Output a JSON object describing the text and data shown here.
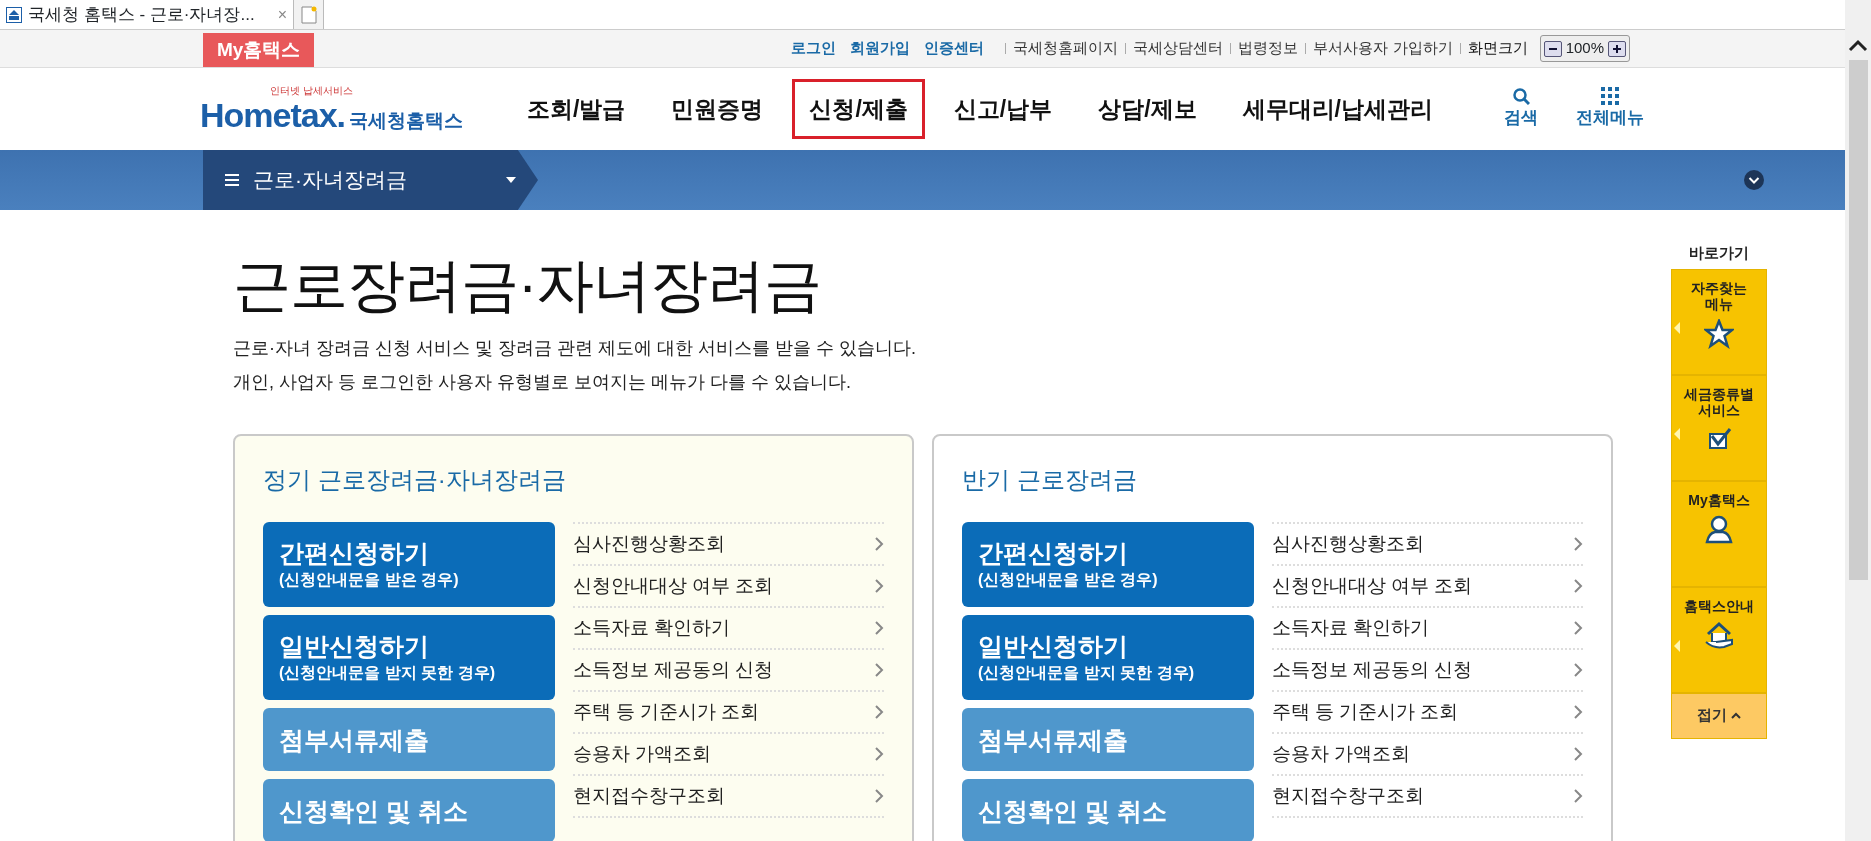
{
  "browser_tab": {
    "title": "국세청 홈택스 - 근로·자녀장...",
    "close": "×"
  },
  "top_bar": {
    "my_hometax": "My홈택스",
    "links": [
      {
        "text": "로그인",
        "kind": "primary"
      },
      {
        "text": "회원가입",
        "kind": "primary"
      },
      {
        "text": "인증센터",
        "kind": "primary"
      },
      {
        "text": "국세청홈페이지",
        "kind": "secondary"
      },
      {
        "text": "국세상담센터",
        "kind": "secondary"
      },
      {
        "text": "법령정보",
        "kind": "secondary"
      },
      {
        "text": "부서사용자 가입하기",
        "kind": "secondary"
      }
    ],
    "zoom": {
      "label": "화면크기",
      "value": "100%"
    }
  },
  "header": {
    "logo": {
      "tagline": "인터넷 납세서비스",
      "brand": "Hometax.",
      "name": "국세청홈택스"
    },
    "nav": [
      {
        "label": "조회/발급",
        "selected": false
      },
      {
        "label": "민원증명",
        "selected": false
      },
      {
        "label": "신청/제출",
        "selected": true
      },
      {
        "label": "신고/납부",
        "selected": false
      },
      {
        "label": "상담/제보",
        "selected": false
      },
      {
        "label": "세무대리/납세관리",
        "selected": false
      }
    ],
    "tools": [
      {
        "label": "검색",
        "kind": "search"
      },
      {
        "label": "전체메뉴",
        "kind": "grid"
      }
    ]
  },
  "subnav": {
    "menu": "근로·자녀장려금"
  },
  "page": {
    "title": "근로장려금·자녀장려금",
    "description": [
      "근로·자녀 장려금 신청 서비스 및 장려금 관련 제도에 대한 서비스를 받을 수 있습니다.",
      "개인, 사업자 등 로그인한 사용자 유형별로 보여지는 메뉴가 다를 수 있습니다."
    ]
  },
  "cards": [
    {
      "title": "정기 근로장려금·자녀장려금",
      "highlighted": true,
      "buttons": [
        {
          "title": "간편신청하기",
          "subtitle": "(신청안내문을 받은 경우)",
          "kind": "primary"
        },
        {
          "title": "일반신청하기",
          "subtitle": "(신청안내문을 받지 못한 경우)",
          "kind": "primary"
        },
        {
          "title": "첨부서류제출",
          "kind": "secondary"
        },
        {
          "title": "신청확인 및 취소",
          "kind": "secondary"
        }
      ],
      "links": [
        "심사진행상황조회",
        "신청안내대상 여부 조회",
        "소득자료 확인하기",
        "소득정보 제공동의 신청",
        "주택 등 기준시가 조회",
        "승용차 가액조회",
        "현지접수창구조회"
      ]
    },
    {
      "title": "반기 근로장려금",
      "highlighted": false,
      "buttons": [
        {
          "title": "간편신청하기",
          "subtitle": "(신청안내문을 받은 경우)",
          "kind": "primary"
        },
        {
          "title": "일반신청하기",
          "subtitle": "(신청안내문을 받지 못한 경우)",
          "kind": "primary"
        },
        {
          "title": "첨부서류제출",
          "kind": "secondary"
        },
        {
          "title": "신청확인 및 취소",
          "kind": "secondary"
        }
      ],
      "links": [
        "심사진행상황조회",
        "신청안내대상 여부 조회",
        "소득자료 확인하기",
        "소득정보 제공동의 신청",
        "주택 등 기준시가 조회",
        "승용차 가액조회",
        "현지접수창구조회"
      ]
    }
  ],
  "quick_menu": {
    "title": "바로가기",
    "items": [
      {
        "label": "자주찾는\n메뉴",
        "kind": "star",
        "expandable": true
      },
      {
        "label": "세금종류별\n서비스",
        "kind": "check",
        "expandable": true
      },
      {
        "label": "My홈택스",
        "kind": "person",
        "expandable": false
      },
      {
        "label": "홈택스안내",
        "kind": "house",
        "expandable": true
      }
    ],
    "collapse": "접기"
  }
}
